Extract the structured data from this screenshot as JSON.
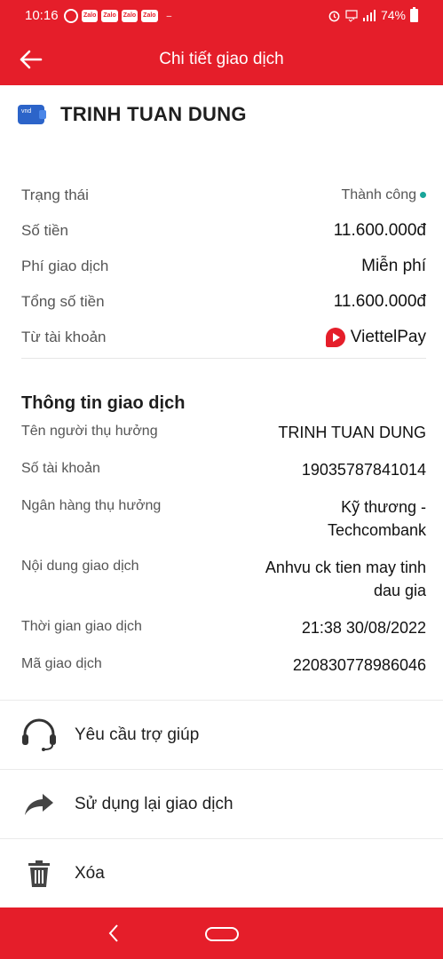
{
  "status_bar": {
    "time": "10:16",
    "chips": [
      "Zalo",
      "Zalo",
      "Zalo",
      "Zalo"
    ],
    "dash": "–",
    "battery": "74%"
  },
  "header": {
    "title": "Chi tiết giao dịch"
  },
  "account": {
    "name": "TRINH TUAN DUNG"
  },
  "summary": {
    "status_label": "Trạng thái",
    "status_value": "Thành công",
    "amount_label": "Số tiền",
    "amount_value": "11.600.000đ",
    "fee_label": "Phí giao dịch",
    "fee_value": "Miễn phí",
    "total_label": "Tổng số tiền",
    "total_value": "11.600.000đ",
    "from_label": "Từ tài khoản",
    "from_value": "ViettelPay"
  },
  "details": {
    "title": "Thông tin giao dịch",
    "rows": [
      {
        "label": "Tên người thụ hưởng",
        "value": "TRINH TUAN DUNG"
      },
      {
        "label": "Số tài khoản",
        "value": "19035787841014"
      },
      {
        "label": "Ngân hàng thụ hưởng",
        "value_line1": "Kỹ thương -",
        "value_line2": "Techcombank"
      },
      {
        "label": "Nội dung giao dịch",
        "value_line1": "Anhvu ck tien may tinh",
        "value_line2": "dau gia"
      },
      {
        "label": "Thời gian giao dịch",
        "value": "21:38 30/08/2022"
      },
      {
        "label": "Mã giao dịch",
        "value": "220830778986046"
      }
    ]
  },
  "actions": {
    "help": "Yêu cầu trợ giúp",
    "reuse": "Sử dụng lại giao dịch",
    "delete": "Xóa"
  },
  "colors": {
    "brand_red": "#e51e2a",
    "success": "#19a59a"
  }
}
